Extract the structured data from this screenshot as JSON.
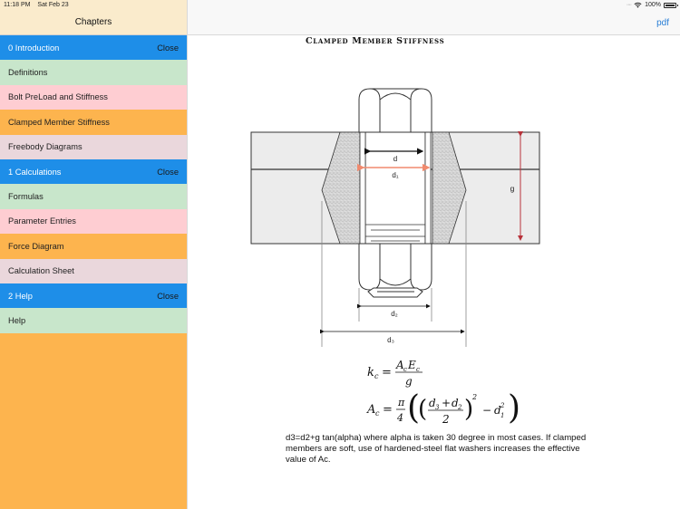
{
  "status_bar": {
    "time": "11:18 PM",
    "date": "Sat Feb 23",
    "battery": "100%"
  },
  "sidebar": {
    "title": "Chapters",
    "sections": [
      {
        "label": "0 Introduction",
        "action": "Close",
        "items": [
          {
            "label": "Definitions",
            "color": "#c8e6cb"
          },
          {
            "label": "Bolt PreLoad and Stiffness",
            "color": "#fecdd2"
          },
          {
            "label": "Clamped Member Stiffness",
            "color": "#fdb44e"
          },
          {
            "label": "Freebody Diagrams",
            "color": "#ead7dc"
          }
        ]
      },
      {
        "label": "1 Calculations",
        "action": "Close",
        "items": [
          {
            "label": "Formulas",
            "color": "#c8e6cb"
          },
          {
            "label": "Parameter Entries",
            "color": "#fecdd2"
          },
          {
            "label": "Force Diagram",
            "color": "#fdb44e"
          },
          {
            "label": "Calculation Sheet",
            "color": "#ead7dc"
          }
        ]
      },
      {
        "label": "2 Help",
        "action": "Close",
        "items": [
          {
            "label": "Help",
            "color": "#c8e6cb"
          }
        ]
      }
    ]
  },
  "main": {
    "pdf_label": "pdf",
    "title": "Clamped Member Stiffness",
    "diagram_labels": {
      "d": "d",
      "d1": "d₁",
      "d2": "d₂",
      "d3": "d₃",
      "g": "g"
    },
    "formulas": {
      "kc_lhs": "k",
      "kc_sub": "c",
      "kc_num": "A",
      "kc_num_sub1": "c",
      "kc_num2": "E",
      "kc_num_sub2": "c",
      "kc_den": "g",
      "ac_lhs": "A",
      "ac_sub": "c",
      "pi": "π",
      "four": "4",
      "d3": "d",
      "d3_sub": "3",
      "plus": "+",
      "d2": "d",
      "d2_sub": "2",
      "two": "2",
      "exp": "2",
      "minus": "−",
      "d1": "d",
      "d1_sub": "1",
      "d1_exp": "2"
    },
    "note": "d3=d2+g tan(alpha) where alpha is taken 30 degree in most cases. If clamped members are soft, use of hardened-steel flat washers increases the effective value of Ac."
  }
}
